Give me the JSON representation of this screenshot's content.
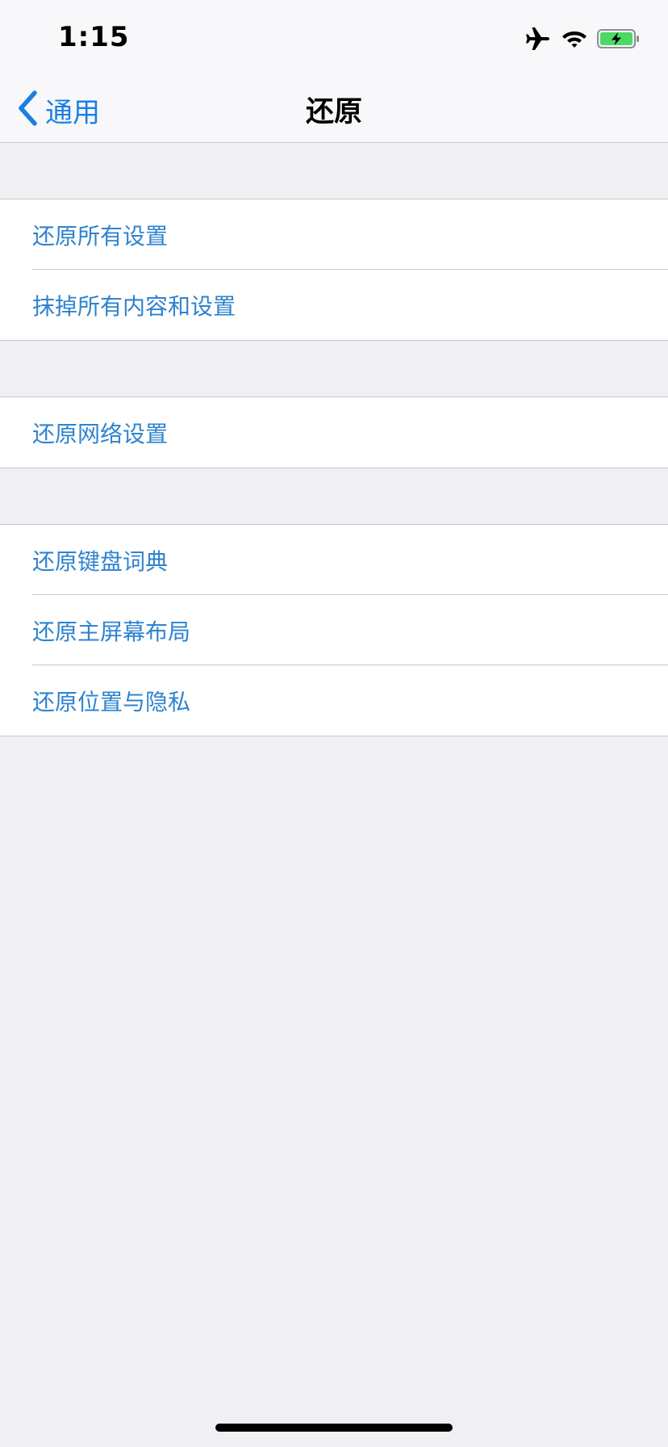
{
  "status_bar": {
    "time": "1:15",
    "icons": [
      "airplane-icon",
      "wifi-icon",
      "battery-charging-icon"
    ],
    "battery_color": "#4cd964"
  },
  "nav": {
    "back_label": "通用",
    "title": "还原"
  },
  "groups": [
    {
      "items": [
        {
          "label": "还原所有设置"
        },
        {
          "label": "抹掉所有内容和设置"
        }
      ]
    },
    {
      "items": [
        {
          "label": "还原网络设置"
        }
      ]
    },
    {
      "items": [
        {
          "label": "还原键盘词典"
        },
        {
          "label": "还原主屏幕布局"
        },
        {
          "label": "还原位置与隐私"
        }
      ]
    }
  ],
  "colors": {
    "accent": "#1a7fe3",
    "row_text": "#2f83cf",
    "background": "#efeff4",
    "separator": "#c8c7cc"
  }
}
